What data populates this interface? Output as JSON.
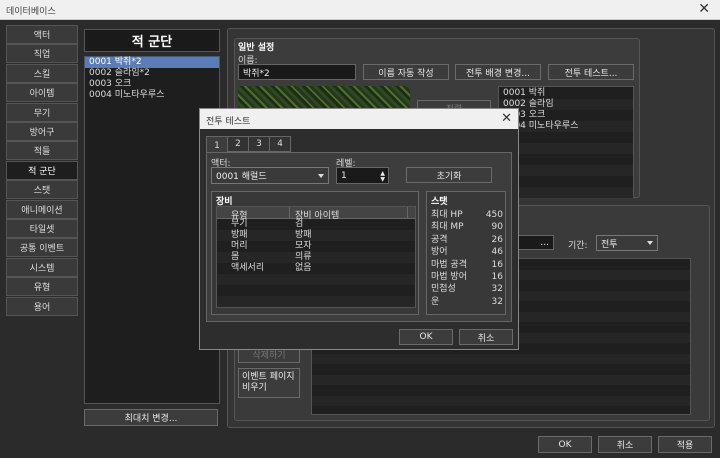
{
  "window": {
    "title": "데이터베이스",
    "close": "✕"
  },
  "nav": [
    "액터",
    "직업",
    "스킬",
    "아이템",
    "무기",
    "방어구",
    "적들",
    "적 군단",
    "스탯",
    "애니메이션",
    "타일셋",
    "공통 이벤트",
    "시스템",
    "유형",
    "용어"
  ],
  "nav_active": 7,
  "troops": {
    "header": "적 군단",
    "items": [
      "0001 박쥐*2",
      "0002 슬라임*2",
      "0003 오크",
      "0004 미노타우루스"
    ],
    "max_button": "최대치 변경..."
  },
  "general": {
    "title": "일반 설정",
    "name_label": "이름:",
    "name_value": "박쥐*2",
    "auto_name": "이름 자동 작성",
    "change_bg": "전투 배경 변경...",
    "battle_test": "전투 테스트...",
    "arrange": "정렬",
    "enemies": [
      "0001 박쥐",
      "0002 슬라임",
      "0003 오크",
      "0004 미노타우루스"
    ],
    "clear_btn": "삭제하기",
    "event_clear": "이벤트 페이지\n비우기",
    "span_label": "기간:",
    "span_value": "전투",
    "ellipsis": "..."
  },
  "dialog": {
    "title": "전투 테스트",
    "close": "✕",
    "tabs": [
      "1",
      "2",
      "3",
      "4"
    ],
    "actor_label": "액터:",
    "actor_value": "0001 해럴드",
    "level_label": "레벨:",
    "level_value": "1",
    "clear": "초기화",
    "equip_title": "장비",
    "equip_headers": [
      "유형",
      "장비 아이템"
    ],
    "equip_rows": [
      [
        "무기",
        "검"
      ],
      [
        "방패",
        "방패"
      ],
      [
        "머리",
        "모자"
      ],
      [
        "몸",
        "의류"
      ],
      [
        "액세서리",
        "없음"
      ]
    ],
    "stats_title": "스탯",
    "stats": [
      [
        "최대 HP",
        "450"
      ],
      [
        "최대 MP",
        "90"
      ],
      [
        "공격",
        "26"
      ],
      [
        "방어",
        "46"
      ],
      [
        "마법 공격",
        "16"
      ],
      [
        "마법 방어",
        "16"
      ],
      [
        "민첩성",
        "32"
      ],
      [
        "운",
        "32"
      ]
    ],
    "ok": "OK",
    "cancel": "취소"
  },
  "footer": {
    "ok": "OK",
    "cancel": "취소",
    "apply": "적용"
  }
}
